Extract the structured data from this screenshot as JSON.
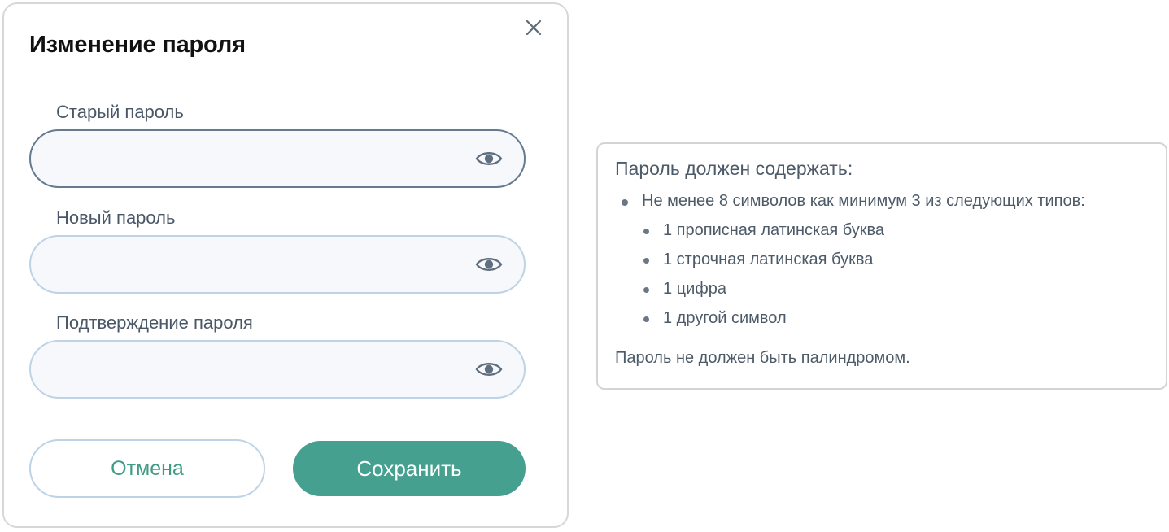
{
  "dialog": {
    "title": "Изменение пароля",
    "fields": [
      {
        "label": "Старый пароль",
        "value": "",
        "placeholder": ""
      },
      {
        "label": "Новый пароль",
        "value": "",
        "placeholder": ""
      },
      {
        "label": "Подтверждение пароля",
        "value": "",
        "placeholder": ""
      }
    ],
    "cancel_label": "Отмена",
    "save_label": "Сохранить",
    "close_icon": "close-icon",
    "eye_icon": "eye-icon"
  },
  "rules": {
    "title": "Пароль должен содержать:",
    "main": "Не менее 8 символов как минимум 3 из следующих типов:",
    "items": [
      "1 прописная латинская буква",
      "1 строчная латинская буква",
      "1 цифра",
      "1 другой символ"
    ],
    "footer": "Пароль не должен быть палиндромом."
  },
  "colors": {
    "accent": "#45a08f",
    "accent_text": "#3e9c86",
    "field_border": "#bfd3e6",
    "field_border_focused": "#667b90",
    "field_bg": "#f6f8fb",
    "text_muted": "#4d5a68"
  }
}
